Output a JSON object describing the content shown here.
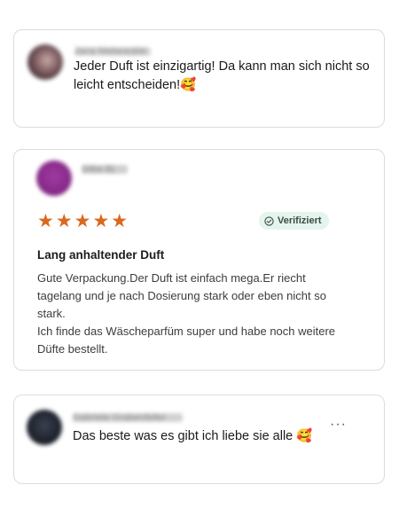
{
  "reviews": [
    {
      "author": "Jana Mebeauble",
      "text": "Jeder Duft ist einzigartig! Da kann man sich nicht so leicht entscheiden!🥰"
    },
    {
      "author": "Silke Bj",
      "rating": 5,
      "stars": "★★★★★",
      "badge": "Verifiziert",
      "title": "Lang anhaltender Duft",
      "body_lines": [
        "Gute Verpackung.Der Duft ist einfach mega.Er riecht tagelang und je nach Dosierung stark oder eben nicht so stark.",
        "Ich finde das Wäscheparfüm super und habe noch weitere Düfte bestellt."
      ]
    },
    {
      "author": "Gabriele Grabenfeller",
      "text": "Das beste was es gibt ich liebe sie alle 🥰",
      "more": "···"
    }
  ],
  "colors": {
    "star": "#d9691e",
    "badge_bg": "#e3f5ec",
    "card_border": "#dcdcdc"
  },
  "icons": {
    "verified": "check-circle-icon",
    "more": "more-horizontal-icon"
  }
}
